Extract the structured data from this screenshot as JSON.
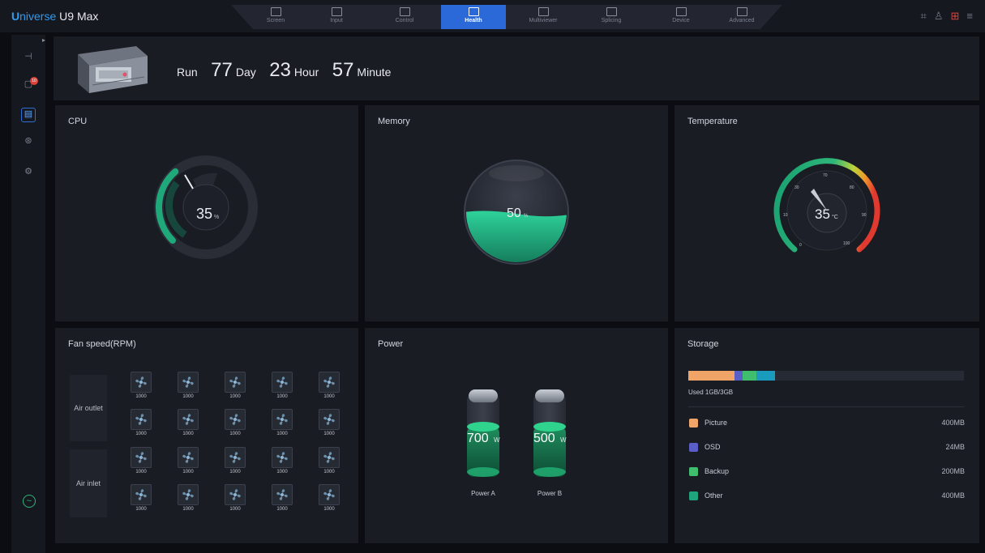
{
  "app": {
    "title_first": "U",
    "title_brand": "niverse",
    "title_model": "U9 Max"
  },
  "nav": [
    {
      "label": "Screen",
      "icon": "screen-icon"
    },
    {
      "label": "Input",
      "icon": "input-icon"
    },
    {
      "label": "Control",
      "icon": "control-icon"
    },
    {
      "label": "Health",
      "icon": "health-icon",
      "active": true
    },
    {
      "label": "Multiviewer",
      "icon": "multiviewer-icon"
    },
    {
      "label": "Splicing",
      "icon": "splicing-icon"
    },
    {
      "label": "Device",
      "icon": "device-icon"
    },
    {
      "label": "Advanced",
      "icon": "advanced-icon"
    }
  ],
  "top_icons": [
    "fullscreen-icon",
    "user-icon",
    "language-icon",
    "menu-icon"
  ],
  "sidebar": {
    "badge": "10",
    "icons": [
      "signal-icon",
      "notification-icon",
      "health-board-icon",
      "network-icon",
      "settings-icon",
      "monitor-icon"
    ]
  },
  "runtime": {
    "run_label": "Run",
    "days": "77",
    "day_label": "Day",
    "hours": "23",
    "hour_label": "Hour",
    "minutes": "57",
    "minute_label": "Minute"
  },
  "cpu": {
    "title": "CPU",
    "value": "35",
    "unit": "%",
    "level": 0.35
  },
  "memory": {
    "title": "Memory",
    "value": "50",
    "unit": "%",
    "level": 0.5
  },
  "temperature": {
    "title": "Temperature",
    "value": "35",
    "unit": "°C",
    "ticks": [
      "0",
      "10",
      "30",
      "70",
      "80",
      "90",
      "100"
    ]
  },
  "fan": {
    "title": "Fan speed(RPM)",
    "outlet_label": "Air outlet",
    "inlet_label": "Air inlet",
    "outlet_values": [
      "1000",
      "1000",
      "1000",
      "1000",
      "1000",
      "1000",
      "1000",
      "1000",
      "1000",
      "1000"
    ],
    "inlet_values": [
      "1000",
      "1000",
      "1000",
      "1000",
      "1000",
      "1000",
      "1000",
      "1000",
      "1000",
      "1000"
    ]
  },
  "power": {
    "title": "Power",
    "a": {
      "value": "700",
      "unit": "W",
      "label": "Power A"
    },
    "b": {
      "value": "500",
      "unit": "W",
      "label": "Power B"
    }
  },
  "storage": {
    "title": "Storage",
    "used_text": "Used 1GB/3GB",
    "items": [
      {
        "name": "Picture",
        "size": "400MB",
        "color": "#f0a468"
      },
      {
        "name": "OSD",
        "size": "24MB",
        "color": "#5a5fc8"
      },
      {
        "name": "Backup",
        "size": "200MB",
        "color": "#3fbf6e"
      },
      {
        "name": "Other",
        "size": "400MB",
        "color": "#1fa47e"
      }
    ]
  }
}
